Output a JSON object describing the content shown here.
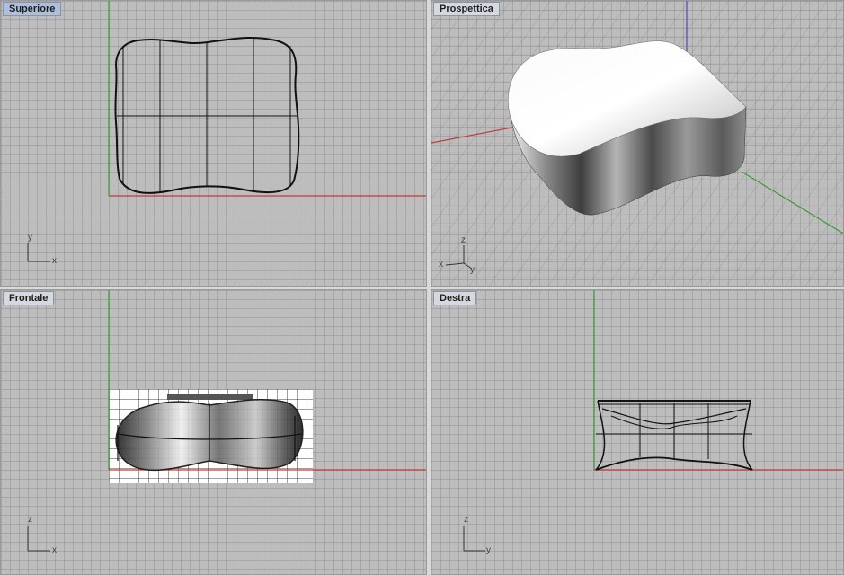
{
  "viewports": {
    "top": {
      "title": "Superiore",
      "axes": {
        "vertical": "y",
        "horizontal": "x"
      }
    },
    "perspective": {
      "title": "Prospettica",
      "axes": {
        "vertical": "z",
        "horizontal_left": "x",
        "horizontal_right": "y"
      }
    },
    "front": {
      "title": "Frontale",
      "axes": {
        "vertical": "z",
        "horizontal": "x"
      }
    },
    "right": {
      "title": "Destra",
      "axes": {
        "vertical": "z",
        "horizontal": "y"
      }
    }
  },
  "colors": {
    "x_axis": "#c43a3a",
    "y_axis": "#3a9a3a",
    "z_axis": "#4a4ab8",
    "curve": "#111111",
    "viewport_bg": "#bdbdbd",
    "title_active": "#aebfdc"
  }
}
